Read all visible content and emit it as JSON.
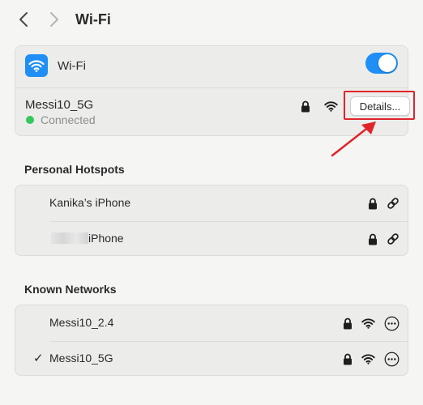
{
  "header": {
    "title": "Wi-Fi",
    "back_icon": "chevron-left-icon",
    "forward_icon": "chevron-right-icon"
  },
  "wifi": {
    "label": "Wi-Fi",
    "enabled": true,
    "current_network": "Messi10_5G",
    "status": "Connected",
    "details_label": "Details...",
    "accent_color": "#1f8ff5",
    "status_color": "#34c759",
    "annotation_color": "#e0242a"
  },
  "personal_hotspots": {
    "title": "Personal Hotspots",
    "items": [
      {
        "name": "Kanika’s iPhone"
      },
      {
        "name": "iPhone"
      }
    ]
  },
  "known_networks": {
    "title": "Known Networks",
    "items": [
      {
        "name": "Messi10_2.4",
        "connected": false
      },
      {
        "name": "Messi10_5G",
        "connected": true,
        "check": "✓"
      }
    ]
  }
}
